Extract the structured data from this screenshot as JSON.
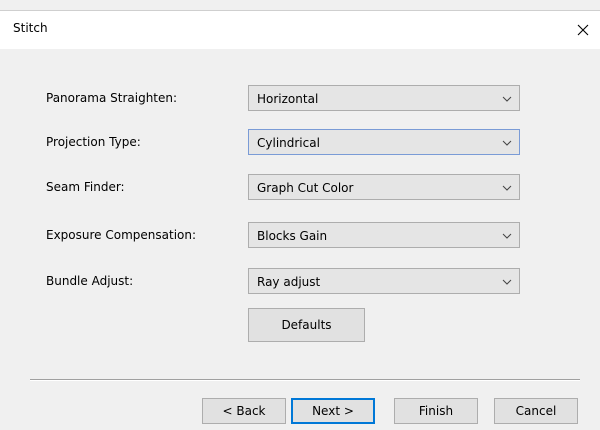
{
  "window": {
    "title": "Stitch"
  },
  "form": {
    "rows": [
      {
        "label": "Panorama Straighten:",
        "value": "Horizontal"
      },
      {
        "label": "Projection Type:",
        "value": "Cylindrical"
      },
      {
        "label": "Seam Finder:",
        "value": "Graph Cut Color"
      },
      {
        "label": "Exposure Compensation:",
        "value": "Blocks Gain"
      },
      {
        "label": "Bundle Adjust:",
        "value": "Ray adjust"
      }
    ],
    "defaults_label": "Defaults"
  },
  "footer": {
    "back_label": "< Back",
    "next_label": "Next >",
    "finish_label": "Finish",
    "cancel_label": "Cancel"
  },
  "colors": {
    "dialog_bg": "#f0f0f0",
    "titlebar_bg": "#ffffff",
    "focus_border": "#0078d7"
  },
  "icons": {
    "close": "close-icon",
    "dropdown": "chevron-down-icon"
  }
}
